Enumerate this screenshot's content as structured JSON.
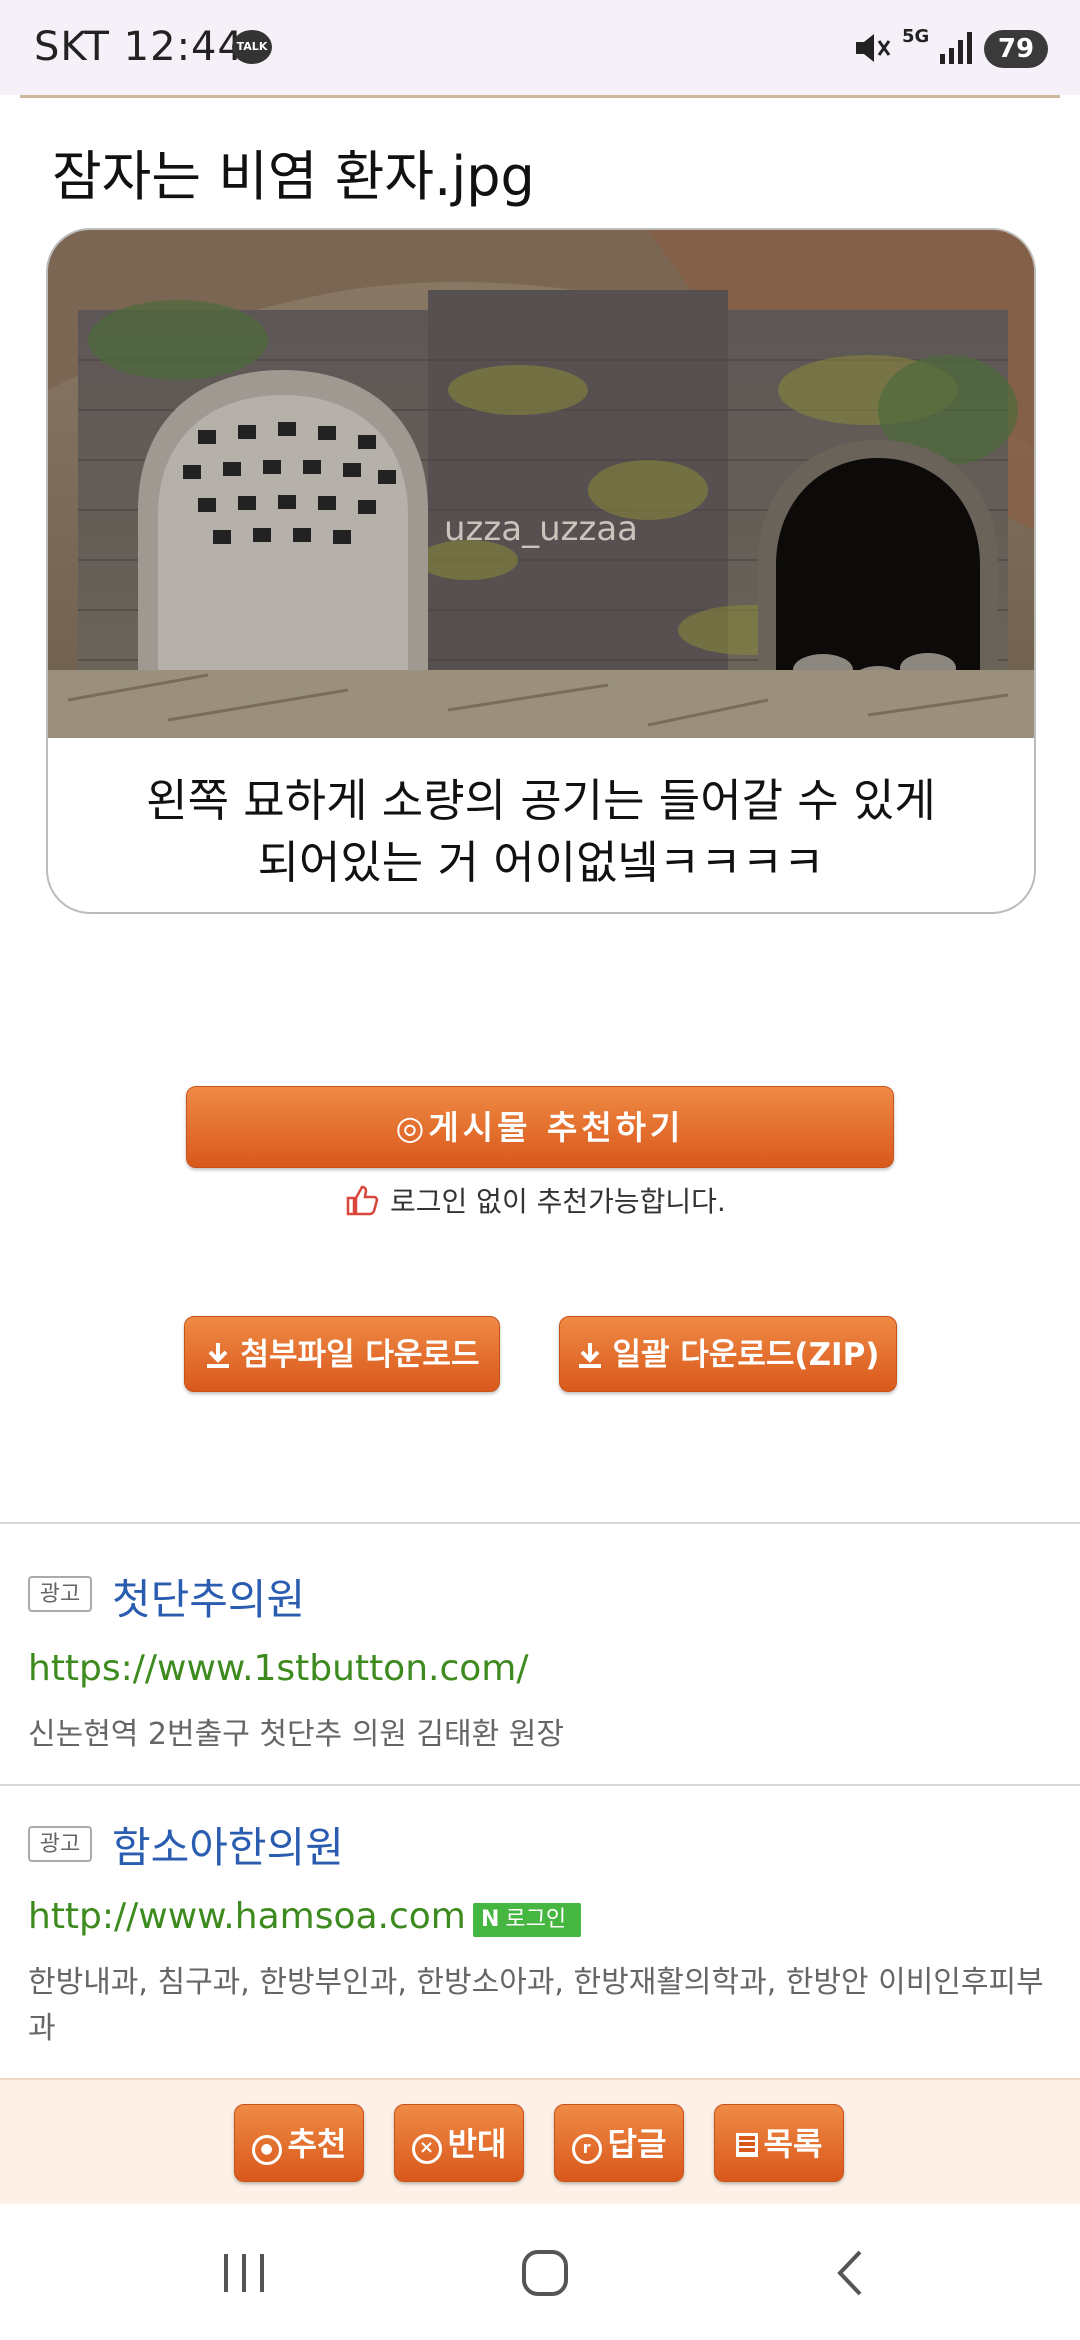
{
  "status_bar": {
    "carrier_time": "SKT 12:44",
    "talk_badge": "TALK",
    "network": "5G",
    "battery": "79",
    "icons": [
      "talk-icon",
      "mute-icon",
      "signal-icon",
      "battery-icon"
    ]
  },
  "post": {
    "title": "잠자는 비염 환자.jpg",
    "image_watermark": "uzza_uzzaa",
    "caption_line1": "왼쪽 묘하게 소량의 공기는 들어갈 수 있게",
    "caption_line2": "되어있는 거 어이없넼ㅋㅋㅋㅋ"
  },
  "recommend": {
    "button_label": "◎게시물  추천하기",
    "login_note": "로그인 없이 추천가능합니다."
  },
  "downloads": {
    "attachment_label": "첨부파일 다운로드",
    "zip_label": "일괄 다운로드(ZIP)"
  },
  "ads": [
    {
      "badge": "광고",
      "title": "첫단추의원",
      "url": "https://www.1stbutton.com/",
      "desc": "신논현역 2번출구 첫단추 의원 김태환 원장"
    },
    {
      "badge": "광고",
      "title": "함소아한의원",
      "url": "http://www.hamsoa.com",
      "login_badge": "로그인",
      "desc": "한방내과, 침구과, 한방부인과, 한방소아과, 한방재활의학과, 한방안 이비인후피부과"
    }
  ],
  "toolbar": {
    "recommend": "추천",
    "oppose": "반대",
    "reply": "답글",
    "list": "목록"
  },
  "colors": {
    "accent_orange": "#e06a2a",
    "ad_title_blue": "#2a5db0",
    "ad_url_green": "#3d8a1e"
  }
}
